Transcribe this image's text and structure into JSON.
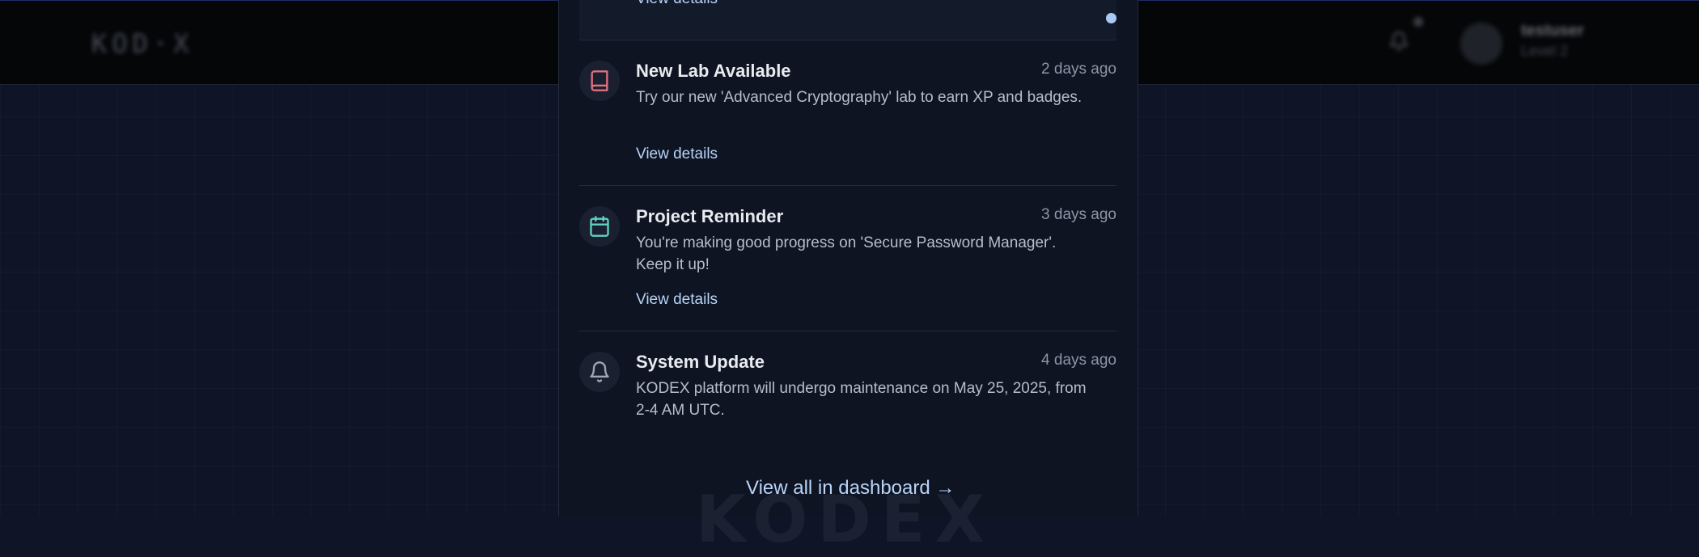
{
  "topbar": {
    "logo": "KOD·X",
    "user_name": "testuser",
    "user_level": "Level 2"
  },
  "notifications": {
    "previous_item": {
      "link_label": "View details"
    },
    "items": [
      {
        "icon": "book-icon",
        "icon_color": "#e0717f",
        "title": "New Lab Available",
        "time": "2 days ago",
        "description": "Try our new 'Advanced Cryptography' lab to earn XP and badges.",
        "link_label": "View details"
      },
      {
        "icon": "calendar-icon",
        "icon_color": "#5fd3c0",
        "title": "Project Reminder",
        "time": "3 days ago",
        "description": "You're making good progress on 'Secure Password Manager'. Keep it up!",
        "link_label": "View details"
      },
      {
        "icon": "bell-icon",
        "icon_color": "#a0a6b2",
        "title": "System Update",
        "time": "4 days ago",
        "description": "KODEX platform will undergo maintenance on May 25, 2025, from 2-4 AM UTC."
      }
    ],
    "view_all_label": "View all in dashboard →"
  },
  "watermark": "KODEX",
  "colors": {
    "accent_link": "#b8d3f7",
    "unread_dot": "#a9c9f5",
    "background": "#0f1526"
  }
}
